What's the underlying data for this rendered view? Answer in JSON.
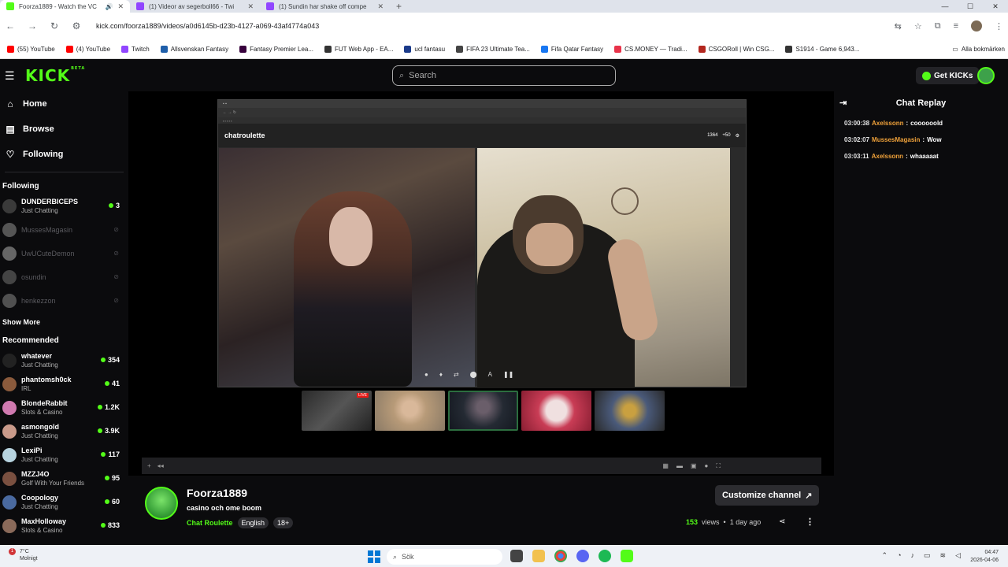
{
  "browser": {
    "tabs": [
      {
        "title": "Foorza1889 - Watch the VC",
        "active": true,
        "favicon": "kick"
      },
      {
        "title": "(1) Videor av segerboll66 - Twi",
        "active": false,
        "favicon": "twitch"
      },
      {
        "title": "(1) Sundin har shake off compe",
        "active": false,
        "favicon": "twitch"
      }
    ],
    "new_tab": "+",
    "url": "kick.com/foorza1889/videos/a0d6145b-d23b-4127-a069-43af4774a043",
    "bookmarks": [
      {
        "label": "(55) YouTube",
        "color": "#ff0000"
      },
      {
        "label": "(4) YouTube",
        "color": "#ff0000"
      },
      {
        "label": "Twitch",
        "color": "#9146ff"
      },
      {
        "label": "Allsvenskan Fantasy",
        "color": "#1f5faa"
      },
      {
        "label": "Fantasy Premier Lea...",
        "color": "#37003c"
      },
      {
        "label": "FUT Web App - EA...",
        "color": "#333333"
      },
      {
        "label": "ucl fantasu",
        "color": "#1a3a8a"
      },
      {
        "label": "FIFA 23 Ultimate Tea...",
        "color": "#444444"
      },
      {
        "label": "Fifa Qatar Fantasy",
        "color": "#1877f2"
      },
      {
        "label": "CS.MONEY — Tradi...",
        "color": "#e8334a"
      },
      {
        "label": "CSGORoll | Win CSG...",
        "color": "#b3261e"
      },
      {
        "label": "S1914 - Game 6,943...",
        "color": "#333333"
      }
    ],
    "all_bookmarks": "Alla bokmärken"
  },
  "header": {
    "logo": "KICK",
    "logo_beta": "BETA",
    "search_placeholder": "Search",
    "get_kicks": "Get KICKs"
  },
  "sidebar": {
    "nav": [
      {
        "label": "Home",
        "icon": "home-icon"
      },
      {
        "label": "Browse",
        "icon": "browse-icon"
      },
      {
        "label": "Following",
        "icon": "heart-icon"
      }
    ],
    "following_title": "Following",
    "following": [
      {
        "name": "DUNDERBICEPS",
        "category": "Just Chatting",
        "viewers": "3",
        "live": true,
        "color": "#3a3a3a"
      },
      {
        "name": "MussesMagasin",
        "live": false,
        "color": "#555555"
      },
      {
        "name": "UwUCuteDemon",
        "live": false,
        "color": "#666666"
      },
      {
        "name": "osundin",
        "live": false,
        "color": "#444444"
      },
      {
        "name": "henkezzon",
        "live": false,
        "color": "#505050"
      }
    ],
    "show_more": "Show More",
    "recommended_title": "Recommended",
    "recommended": [
      {
        "name": "whatever",
        "category": "Just Chatting",
        "viewers": "354",
        "color": "#222222"
      },
      {
        "name": "phantomsh0ck",
        "category": "IRL",
        "viewers": "41",
        "color": "#8a5a3c"
      },
      {
        "name": "BlondeRabbit",
        "category": "Slots & Casino",
        "viewers": "1.2K",
        "color": "#d07ab0"
      },
      {
        "name": "asmongold",
        "category": "Just Chatting",
        "viewers": "3.9K",
        "color": "#c99a8a"
      },
      {
        "name": "LexiPi",
        "category": "Just Chatting",
        "viewers": "117",
        "color": "#b8d4e0"
      },
      {
        "name": "MZZJ4O",
        "category": "Golf With Your Friends",
        "viewers": "95",
        "color": "#7a5040"
      },
      {
        "name": "Coopology",
        "category": "Just Chatting",
        "viewers": "60",
        "color": "#4a6aa0"
      },
      {
        "name": "MaxHolloway",
        "category": "Slots & Casino",
        "viewers": "833",
        "color": "#8a6a5a"
      }
    ]
  },
  "player": {
    "inner_app": "chatroulette",
    "inner_coins": "1364",
    "inner_plus": "+50"
  },
  "stream": {
    "streamer": "Foorza1889",
    "title": "casino och ome boom",
    "category": "Chat Roulette",
    "tags": [
      "English",
      "18+"
    ],
    "customize": "Customize channel",
    "views": "153",
    "views_label": "views",
    "separator": "•",
    "ago": "1 day ago"
  },
  "chat": {
    "title": "Chat Replay",
    "messages": [
      {
        "time": "03:00:38",
        "user": "Axelssonn",
        "text": "coooooold"
      },
      {
        "time": "03:02:07",
        "user": "MussesMagasin",
        "text": "Wow"
      },
      {
        "time": "03:03:11",
        "user": "Axelssonn",
        "text": "whaaaaat"
      }
    ]
  },
  "taskbar": {
    "weather_temp": "7°C",
    "weather_desc": "Molnigt",
    "weather_badge": "1",
    "search": "Sök",
    "time": "04:47",
    "date": "2026-04-06"
  }
}
